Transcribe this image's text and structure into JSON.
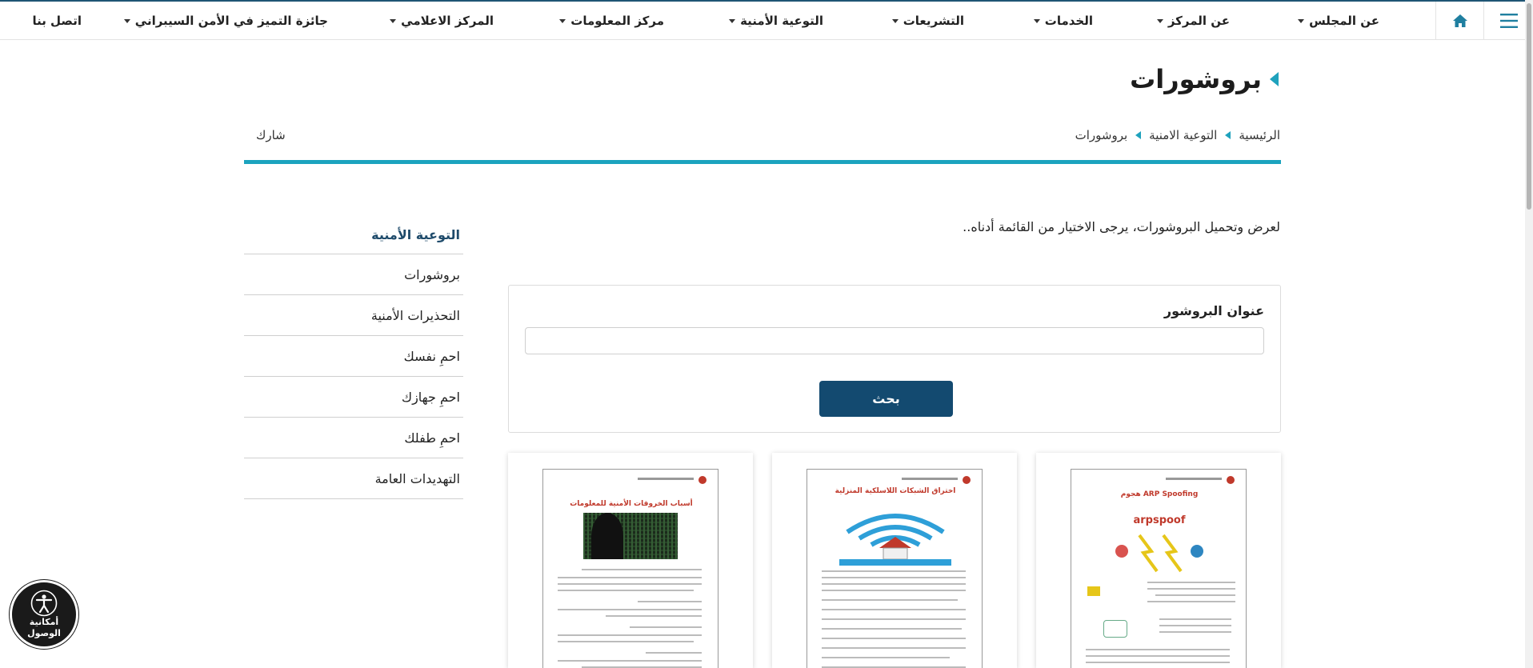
{
  "nav": {
    "items": [
      {
        "label": "عن المجلس",
        "has_caret": true
      },
      {
        "label": "عن المركز",
        "has_caret": true
      },
      {
        "label": "الخدمات",
        "has_caret": true
      },
      {
        "label": "التشريعات",
        "has_caret": true
      },
      {
        "label": "التوعية الأمنية",
        "has_caret": true
      },
      {
        "label": "مركز المعلومات",
        "has_caret": true
      },
      {
        "label": "المركز الاعلامي",
        "has_caret": true
      },
      {
        "label": "جائزة التميز في الأمن السيبراني",
        "has_caret": true
      },
      {
        "label": "اتصل بنا",
        "has_caret": false
      }
    ],
    "home_icon": "home-icon",
    "menu_icon": "hamburger-icon"
  },
  "page": {
    "title": "بروشورات",
    "share_label": "شارك",
    "intro_text": "لعرض وتحميل البروشورات، يرجى الاختيار من القائمة أدناه.."
  },
  "breadcrumb": [
    "الرئيسية",
    "التوعية الامنية",
    "بروشورات"
  ],
  "sidebar": {
    "heading": "التوعية الأمنية",
    "items": [
      "بروشورات",
      "التحذيرات الأمنية",
      "احمِ نفسك",
      "احمِ جهازك",
      "احمِ طفلك",
      "التهديدات العامة"
    ]
  },
  "search": {
    "label": "عنوان البروشور",
    "value": "",
    "placeholder": "",
    "button_label": "بحث"
  },
  "brochures": [
    {
      "title": "هجوم ARP Spoofing",
      "subtitle": "arpspoof"
    },
    {
      "title": "اختراق الشبكات اللاسلكية المنزلية"
    },
    {
      "title": "أسباب الخروقات الأمنية للمعلومات"
    }
  ],
  "accessibility": {
    "label": "أمكانية الوصول",
    "icon": "accessibility-icon"
  },
  "colors": {
    "accent": "#1ba3be",
    "navy": "#134a70",
    "heading": "#1f4b6b"
  }
}
